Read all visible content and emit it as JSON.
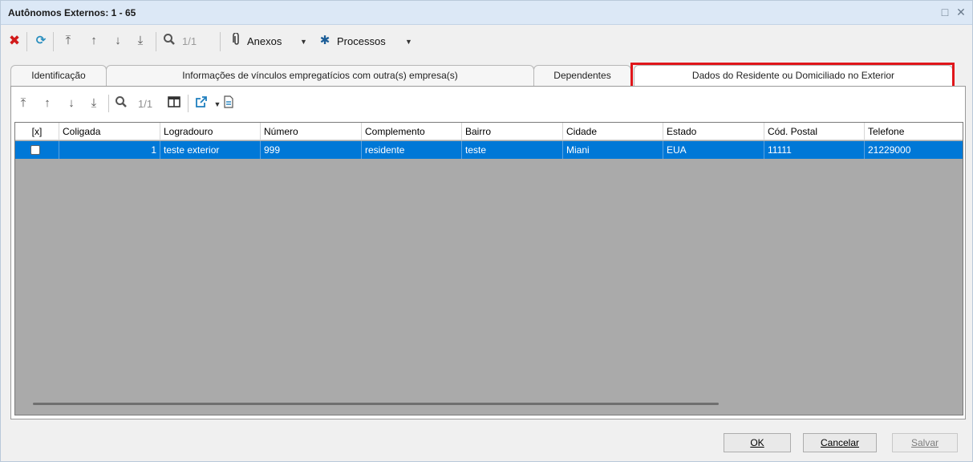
{
  "window": {
    "title": "Autônomos Externos: 1 - 65",
    "maximize_glyph": "□",
    "close_glyph": "✕"
  },
  "toolbar": {
    "icons": [
      "close-red-icon",
      "refresh-icon",
      "first-record-icon",
      "previous-record-icon",
      "next-record-icon",
      "last-record-icon",
      "search-icon"
    ],
    "page_indicator": "1/1",
    "anexos_label": "Anexos",
    "processos_label": "Processos"
  },
  "tabs": [
    {
      "label": "Identificação",
      "active": false
    },
    {
      "label": "Informações de vínculos empregatícios com outra(s) empresa(s)",
      "active": false
    },
    {
      "label": "Dependentes",
      "active": false
    },
    {
      "label": "Dados do Residente ou Domiciliado no Exterior",
      "active": true
    }
  ],
  "subtoolbar": {
    "page_indicator": "1/1"
  },
  "grid": {
    "columns": [
      "[x]",
      "Coligada",
      "Logradouro",
      "Número",
      "Complemento",
      "Bairro",
      "Cidade",
      "Estado",
      "Cód. Postal",
      "Telefone"
    ],
    "rows": [
      {
        "selected": true,
        "checked": false,
        "cells": [
          "",
          "1",
          "teste exterior",
          "999",
          "residente",
          "teste",
          "Miani",
          "EUA",
          "11111",
          "21229000"
        ]
      }
    ]
  },
  "buttons": {
    "ok": "OK",
    "cancelar": "Cancelar",
    "salvar": "Salvar"
  },
  "colors": {
    "titlebar": "#dce8f6",
    "selection": "#0078d7",
    "highlight_box": "#e0161b",
    "grid_background": "#aaaaaa"
  }
}
